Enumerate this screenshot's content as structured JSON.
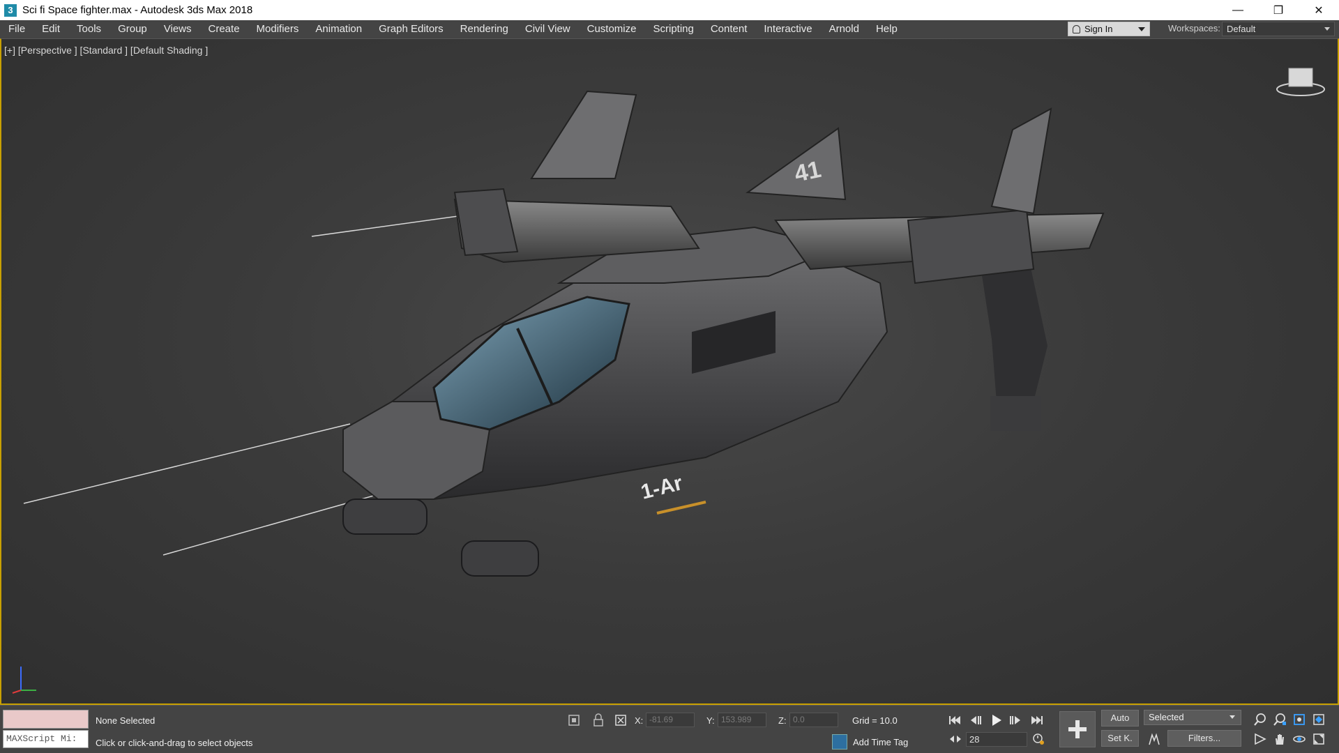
{
  "window": {
    "title": "Sci fi Space fighter.max - Autodesk 3ds Max 2018",
    "app_icon": "3",
    "minimize": "—",
    "restore": "❐",
    "close": "✕"
  },
  "menu": {
    "items": [
      "File",
      "Edit",
      "Tools",
      "Group",
      "Views",
      "Create",
      "Modifiers",
      "Animation",
      "Graph Editors",
      "Rendering",
      "Civil View",
      "Customize",
      "Scripting",
      "Content",
      "Interactive",
      "Arnold",
      "Help"
    ],
    "sign_in": "Sign In",
    "workspaces_label": "Workspaces:",
    "workspace_value": "Default"
  },
  "viewport": {
    "label": "[+] [Perspective ] [Standard ] [Default Shading ]",
    "decals": {
      "tail": "41",
      "side": "1-Ar"
    }
  },
  "status": {
    "selection": "None Selected",
    "prompt": "Click or click-and-drag to select objects",
    "maxscript": "MAXScript Mi:",
    "x_label": "X:",
    "x_value": "-81.69",
    "y_label": "Y:",
    "y_value": "153.989",
    "z_label": "Z:",
    "z_value": "0.0",
    "grid": "Grid = 10.0",
    "add_time_tag": "Add Time Tag",
    "frame": "28",
    "auto": "Auto",
    "set_key": "Set K.",
    "selected_dropdown": "Selected",
    "filters": "Filters..."
  },
  "colors": {
    "viewport_border": "#c8a000",
    "menu_bg": "#444444",
    "mini_listener": "#e9c9c9"
  }
}
